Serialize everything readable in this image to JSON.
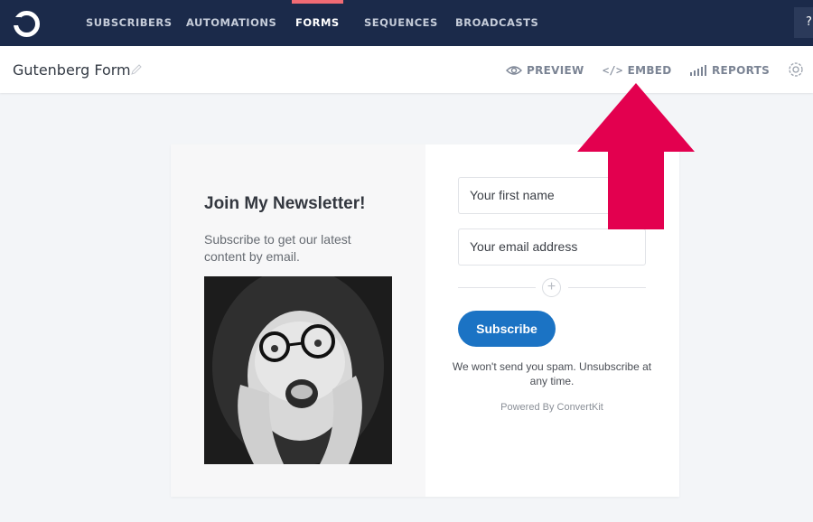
{
  "nav": {
    "items": [
      "SUBSCRIBERS",
      "AUTOMATIONS",
      "FORMS",
      "SEQUENCES",
      "BROADCASTS"
    ],
    "active": "FORMS",
    "help_label": "?"
  },
  "header": {
    "title": "Gutenberg Form",
    "tabs": [
      {
        "label": "PREVIEW",
        "icon": "eye-icon"
      },
      {
        "label": "EMBED",
        "icon": "code-icon"
      },
      {
        "label": "REPORTS",
        "icon": "bar-chart-icon"
      }
    ]
  },
  "form": {
    "headline": "Join My Newsletter!",
    "subtext": "Subscribe to get our latest content by email.",
    "first_name_placeholder": "Your first name",
    "email_placeholder": "Your email address",
    "button_label": "Subscribe",
    "spam_text": "We won't send you spam. Unsubscribe at any time.",
    "powered_by": "Powered By ConvertKit"
  },
  "colors": {
    "nav_bg": "#1b2a4a",
    "active_underline": "#f06b74",
    "button_blue": "#1b73c4",
    "arrow_red": "#e3004f"
  }
}
